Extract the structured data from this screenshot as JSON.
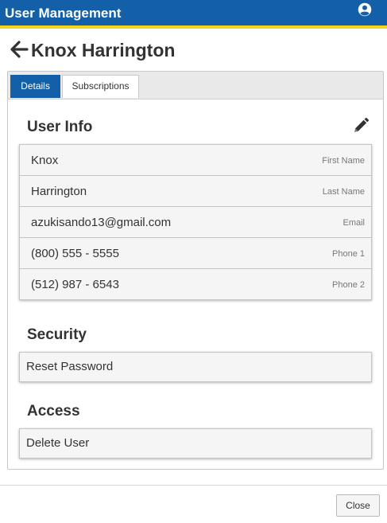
{
  "header": {
    "title": "User Management",
    "account_icon": "account-circle-icon"
  },
  "page": {
    "title": "Knox Harrington",
    "back_icon": "arrow-left-icon"
  },
  "tabs": [
    {
      "label": "Details",
      "active": true
    },
    {
      "label": "Subscriptions",
      "active": false
    }
  ],
  "user_info": {
    "heading": "User Info",
    "edit_icon": "pencil-icon",
    "fields": [
      {
        "value": "Knox",
        "label": "First Name"
      },
      {
        "value": "Harrington",
        "label": "Last Name"
      },
      {
        "value": "azukisando13@gmail.com",
        "label": "Email"
      },
      {
        "value": "(800) 555 - 5555",
        "label": "Phone 1"
      },
      {
        "value": "(512) 987 - 6543",
        "label": "Phone 2"
      }
    ]
  },
  "security": {
    "heading": "Security",
    "action_label": "Reset Password"
  },
  "access": {
    "heading": "Access",
    "action_label": "Delete User"
  },
  "footer": {
    "close_label": "Close"
  },
  "colors": {
    "brand_blue": "#1460a8",
    "accent_yellow": "#f5d31c"
  }
}
